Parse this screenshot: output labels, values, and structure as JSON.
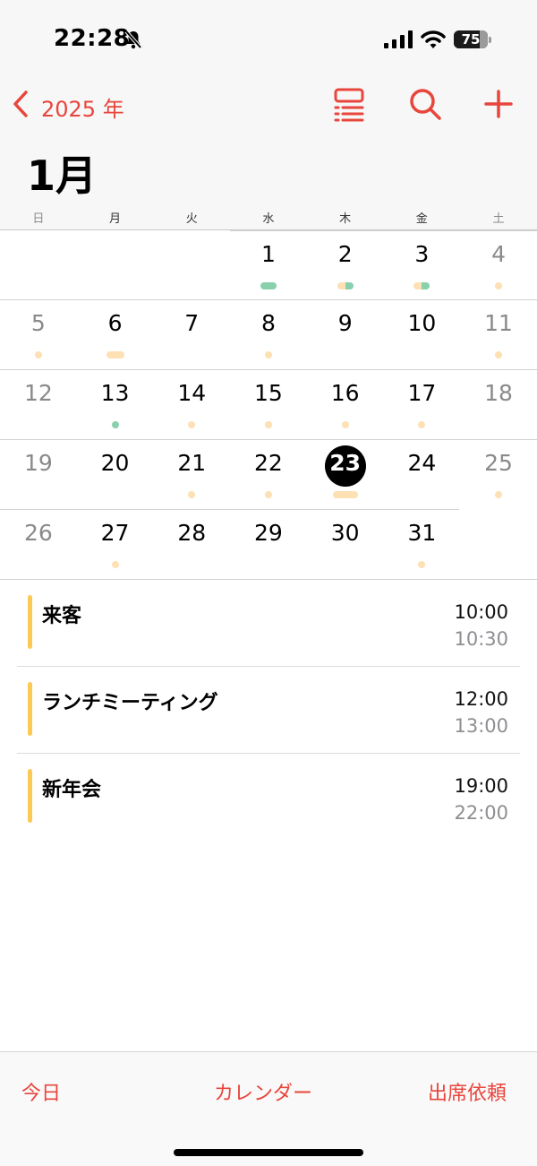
{
  "status_bar": {
    "time": "22:28",
    "battery": "75",
    "battery_level_percent": 75
  },
  "nav": {
    "back_label": "2025 年"
  },
  "calendar": {
    "month_title": "1月",
    "weekdays": [
      "日",
      "月",
      "火",
      "水",
      "木",
      "金",
      "土"
    ],
    "weeks": [
      [
        "",
        "",
        "",
        "1",
        "2",
        "3",
        "4"
      ],
      [
        "5",
        "6",
        "7",
        "8",
        "9",
        "10",
        "11"
      ],
      [
        "12",
        "13",
        "14",
        "15",
        "16",
        "17",
        "18"
      ],
      [
        "19",
        "20",
        "21",
        "22",
        "23",
        "24",
        "25"
      ],
      [
        "26",
        "27",
        "28",
        "29",
        "30",
        "31",
        ""
      ]
    ],
    "today": "23"
  },
  "events": [
    {
      "title": "来客",
      "start": "10:00",
      "end": "10:30"
    },
    {
      "title": "ランチミーティング",
      "start": "12:00",
      "end": "13:00"
    },
    {
      "title": "新年会",
      "start": "19:00",
      "end": "22:00"
    }
  ],
  "tab_bar": {
    "today": "今日",
    "calendars": "カレンダー",
    "inbox": "出席依頼"
  },
  "colors": {
    "accent": "#e8453c",
    "event_yellow": "#fcc955",
    "dot_peach": "#fde0b4",
    "dot_green": "#88d1ac"
  }
}
